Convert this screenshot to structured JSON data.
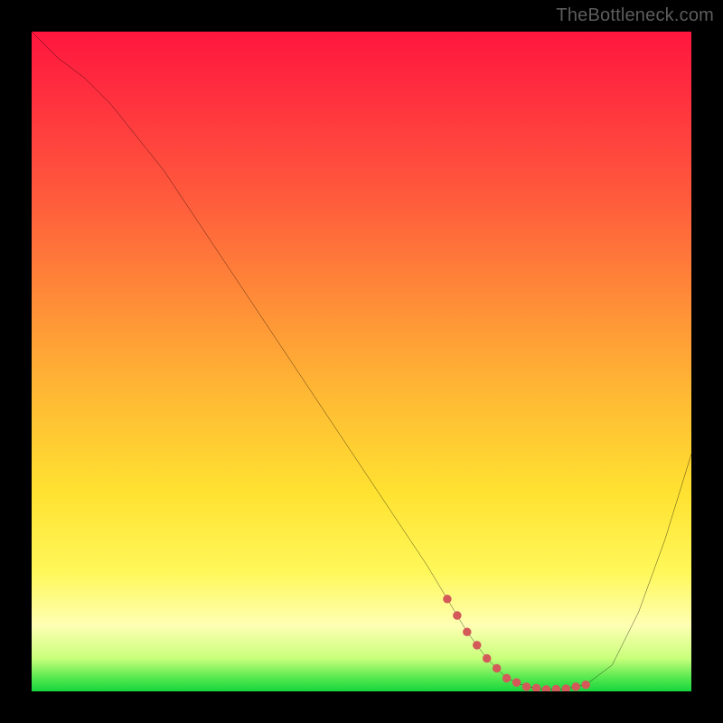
{
  "watermark": "TheBottleneck.com",
  "colors": {
    "background": "#000000",
    "curve": "#000000",
    "dotted_segment": "#d45a5a",
    "gradient_top": "#ff163e",
    "gradient_bottom": "#17d53e"
  },
  "chart_data": {
    "type": "line",
    "title": "",
    "xlabel": "",
    "ylabel": "",
    "xlim": [
      0,
      100
    ],
    "ylim": [
      0,
      100
    ],
    "grid": false,
    "legend": false,
    "note": "Background vertical gradient red→green represents a secondary axis (worse→better). Values are estimated from pixel positions; chart has no numeric tick labels.",
    "series": [
      {
        "name": "bottleneck-curve",
        "x": [
          0,
          4,
          8,
          12,
          16,
          20,
          24,
          28,
          32,
          36,
          40,
          44,
          48,
          52,
          56,
          60,
          63,
          66,
          69,
          72,
          75,
          78,
          81,
          84,
          88,
          92,
          96,
          100
        ],
        "y": [
          100,
          96,
          93,
          89,
          84,
          79,
          73,
          67,
          61,
          55,
          49,
          43,
          37,
          31,
          25,
          19,
          14,
          9,
          5,
          2,
          0.7,
          0.3,
          0.4,
          1.0,
          4,
          12,
          23,
          36
        ]
      }
    ],
    "optimum_segment": {
      "name": "optimal-range-dotted",
      "x": [
        63,
        66,
        69,
        72,
        75,
        78,
        81,
        84
      ],
      "y": [
        14,
        9,
        5,
        2,
        0.7,
        0.3,
        0.4,
        1.0
      ]
    }
  }
}
